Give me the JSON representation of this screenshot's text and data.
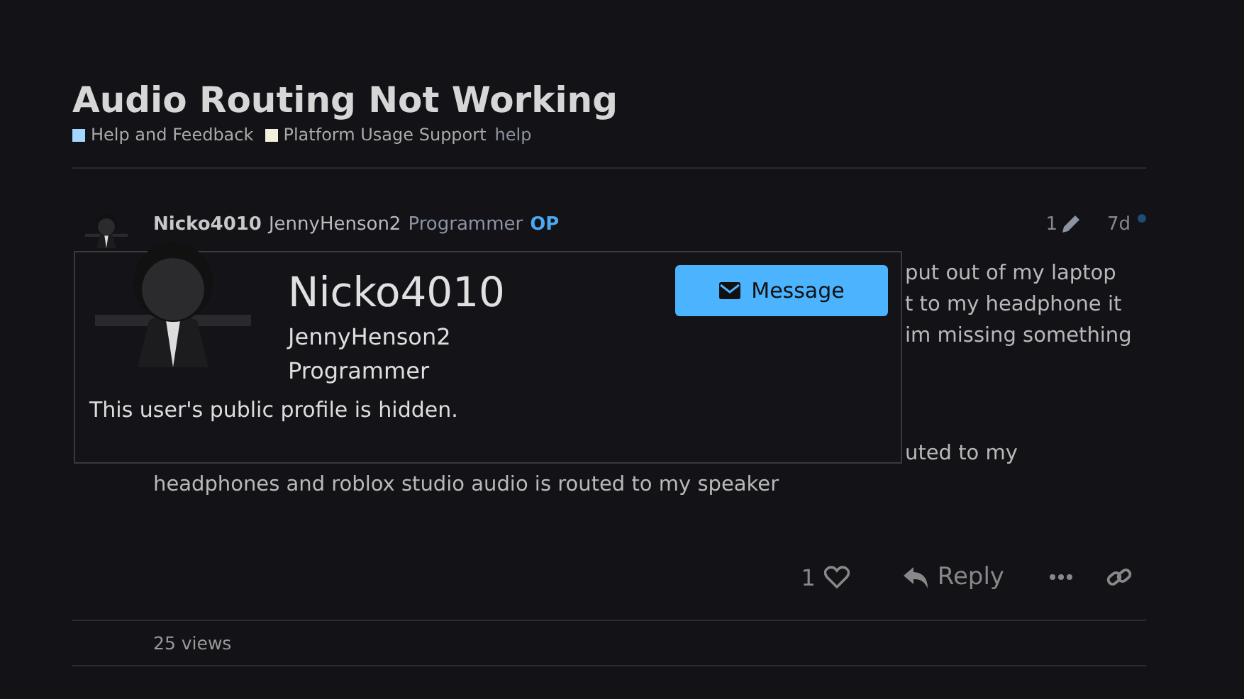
{
  "topic": {
    "title": "Audio Routing Not Working",
    "categories": [
      {
        "name": "Help and Feedback",
        "color": "#a3d7ff"
      },
      {
        "name": "Platform Usage Support",
        "color": "#f1f1de"
      }
    ],
    "tags": [
      "help"
    ]
  },
  "post": {
    "username": "Nicko4010",
    "name": "JennyHenson2",
    "title": "Programmer",
    "op_badge": "OP",
    "edits": "1",
    "age": "7d",
    "unread": true,
    "body": [
      [
        {
          "kind": "cut",
          "text": "put out of my laptop"
        },
        {
          "kind": "cut",
          "text": "t to my headphone it"
        },
        {
          "kind": "cut",
          "text": "im missing something"
        }
      ],
      [
        {
          "kind": "cut",
          "text": "uted to my"
        },
        {
          "kind": "full",
          "text": "headphones and roblox studio audio is routed to my speaker"
        }
      ]
    ],
    "likes": "1",
    "liked": false,
    "reply_label": "Reply"
  },
  "user_card": {
    "username": "Nicko4010",
    "name": "JennyHenson2",
    "title": "Programmer",
    "message_label": "Message",
    "notice": "This user's public profile is hidden."
  },
  "views": "25 views"
}
